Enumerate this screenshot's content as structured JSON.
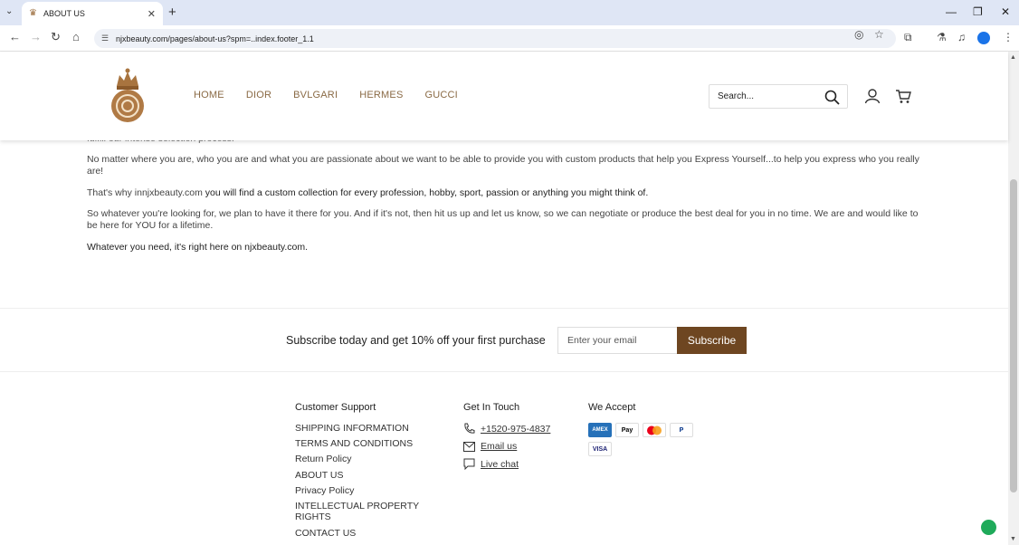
{
  "browser": {
    "tab_title": "ABOUT US",
    "url": "njxbeauty.com/pages/about-us?spm=..index.footer_1.1"
  },
  "header": {
    "nav": [
      "HOME",
      "DIOR",
      "BVLGARI",
      "HERMES",
      "GUCCI"
    ],
    "search_placeholder": "Search..."
  },
  "content": {
    "cut_line": "fulfill our intense selection process.",
    "p1": "No matter where you are, who you are and what you are passionate about we want to be able to provide you with custom products that help you Express Yourself...to help you express who you really are!",
    "p2_a": "That's why innjxbeauty.com",
    "p2_b": " you will find a custom collection for every profession, hobby, sport, passion or anything you might think of.",
    "p3": "So whatever you're looking for, we plan to have it there for you. And if it's not, then hit us up and let us know, so we can negotiate or produce the best deal for you in no time. We are and would like to be here for YOU for a lifetime.",
    "p4": "Whatever you need, it's right here on njxbeauty.com."
  },
  "subscribe": {
    "text": "Subscribe today and get 10% off your first purchase",
    "placeholder": "Enter your email",
    "button": "Subscribe"
  },
  "footer": {
    "support_title": "Customer Support",
    "support_links": [
      "SHIPPING INFORMATION",
      "TERMS AND CONDITIONS",
      "Return Policy",
      "ABOUT US",
      "Privacy Policy",
      "INTELLECTUAL PROPERTY RIGHTS",
      "CONTACT US"
    ],
    "touch_title": "Get In Touch",
    "phone": "+1520-975-4837",
    "email": "Email us",
    "chat": "Live chat",
    "accept_title": "We Accept",
    "payments": [
      "AMEX",
      "Apple Pay",
      "Mastercard",
      "PayPal",
      "VISA"
    ]
  },
  "colors": {
    "brand": "#6e4621",
    "nav": "#8a6a45",
    "chrome": "#dfe6f5"
  }
}
